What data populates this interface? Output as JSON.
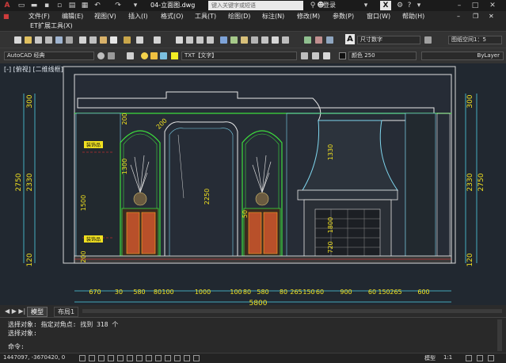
{
  "window": {
    "title": "04-立面图.dwg",
    "search_placeholder": "键入关键字或短语",
    "login_label": "登录",
    "help_label": "?"
  },
  "menu": {
    "items": [
      "文件(F)",
      "编辑(E)",
      "视图(V)",
      "插入(I)",
      "格式(O)",
      "工具(T)",
      "绘图(D)",
      "标注(N)",
      "修改(M)",
      "参数(P)",
      "窗口(W)",
      "帮助(H)"
    ],
    "extension": "ET扩展工具(X)"
  },
  "toolbar": {
    "dim_style": "尺寸数字",
    "scale": "图纸空间1：5",
    "workspace": "AutoCAD 经典",
    "layer": "TXT【文字】",
    "color": "颜色 250",
    "linetype": "ByLayer",
    "annotation_letter": "A"
  },
  "viewport": {
    "label": "[-] [俯视] [二维线框]"
  },
  "tabs": [
    "模型",
    "布局1"
  ],
  "command": {
    "line1": "选择对象: 指定对角点: 找到 318 个",
    "line2": "选择对象:",
    "prompt": "命令:"
  },
  "status": {
    "coordinates": "1447097, -3670420, 0",
    "model_label": "模型",
    "annotation_scale": "1:1"
  },
  "drawing": {
    "left_dims": [
      "300",
      "2330",
      "2750",
      "120"
    ],
    "right_dims": [
      "300",
      "2330",
      "2750",
      "120"
    ],
    "inner_dims": [
      "200",
      "1300",
      "1500",
      "200",
      "2250",
      "1330",
      "50",
      "1800",
      "720"
    ],
    "bottom_dims": [
      "670",
      "30",
      "580",
      "80",
      "100",
      "1000",
      "100",
      "80",
      "580",
      "80",
      "265",
      "150",
      "60",
      "900",
      "60",
      "150",
      "265",
      "600"
    ],
    "total_dim": "5800",
    "rotated_dim": "200",
    "labels": [
      "装饰品",
      "装饰品"
    ]
  },
  "colors": {
    "canvas_bg": "#212830",
    "frame_line": "#e8e8e8",
    "dim_text": "#f0e020",
    "green_line": "#3ddc3d",
    "cyan_line": "#4fd0e6",
    "red_line": "#ff3030",
    "dark_text": "#101010"
  }
}
